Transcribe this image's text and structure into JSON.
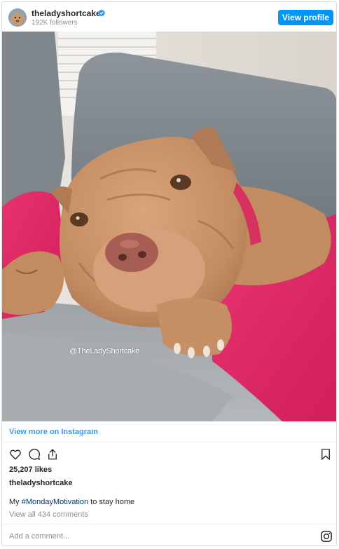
{
  "header": {
    "username": "theladyshortcake",
    "followers": "192K followers",
    "view_profile_label": "View profile",
    "verified_icon": "verified-badge-icon",
    "accent_color": "#0095f6"
  },
  "photo": {
    "watermark": "@TheLadyShortcake"
  },
  "footer": {
    "view_more_label": "View more on Instagram",
    "likes": "25,207 likes",
    "author": "theladyshortcake",
    "caption_text_before": "My ",
    "caption_hashtag": "#MondayMotivation",
    "caption_text_after": " to stay home",
    "comments_link": "View all 434 comments",
    "comment_placeholder": "Add a comment...",
    "icons": [
      "heart-icon",
      "comment-icon",
      "share-icon",
      "bookmark-icon",
      "instagram-icon"
    ]
  }
}
